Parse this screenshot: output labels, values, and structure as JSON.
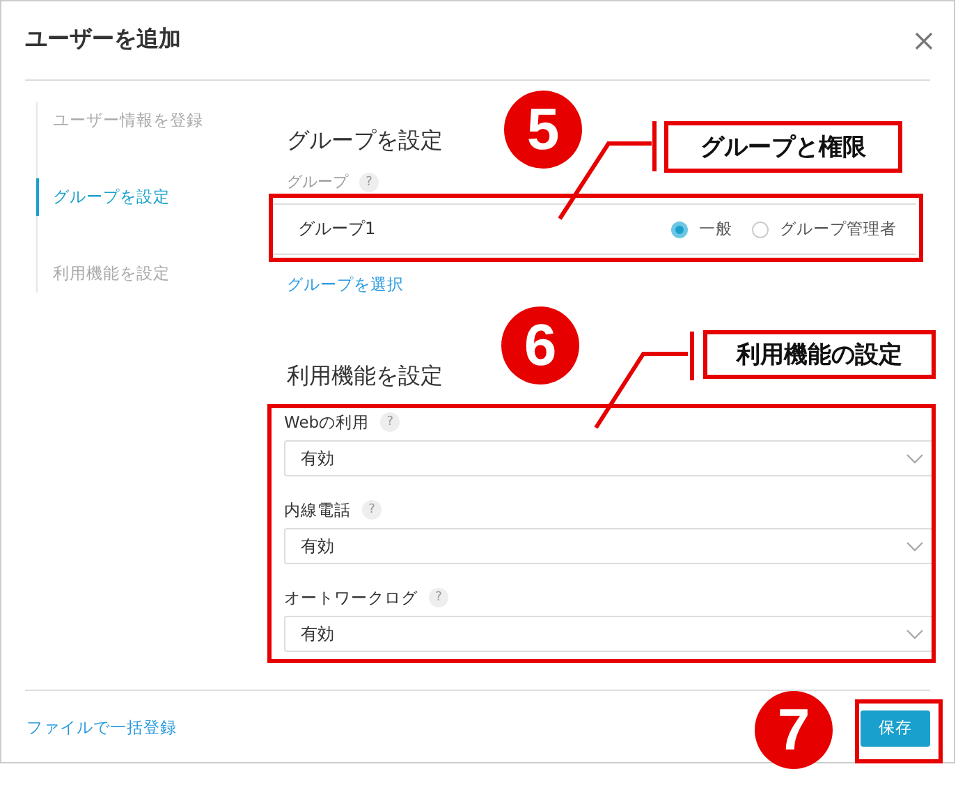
{
  "dialog": {
    "title": "ユーザーを追加"
  },
  "steps": [
    {
      "label": "ユーザー情報を登録",
      "selected": false
    },
    {
      "label": "グループを設定",
      "selected": true
    },
    {
      "label": "利用機能を設定",
      "selected": false
    }
  ],
  "group_section": {
    "heading": "グループを設定",
    "field_label": "グループ",
    "help": "?",
    "group_name": "グループ1",
    "roles": [
      {
        "label": "一般",
        "selected": true
      },
      {
        "label": "グループ管理者",
        "selected": false
      }
    ],
    "select_link": "グループを選択"
  },
  "feature_section": {
    "heading": "利用機能を設定",
    "fields": [
      {
        "label": "Webの利用",
        "help": "?",
        "value": "有効"
      },
      {
        "label": "内線電話",
        "help": "?",
        "value": "有効"
      },
      {
        "label": "オートワークログ",
        "help": "?",
        "value": "有効"
      }
    ]
  },
  "footer": {
    "bulk_link": "ファイルで一括登録",
    "save_button": "保存"
  },
  "annotations": [
    {
      "number": "5",
      "label": "グループと権限"
    },
    {
      "number": "6",
      "label": "利用機能の設定"
    },
    {
      "number": "7"
    }
  ]
}
